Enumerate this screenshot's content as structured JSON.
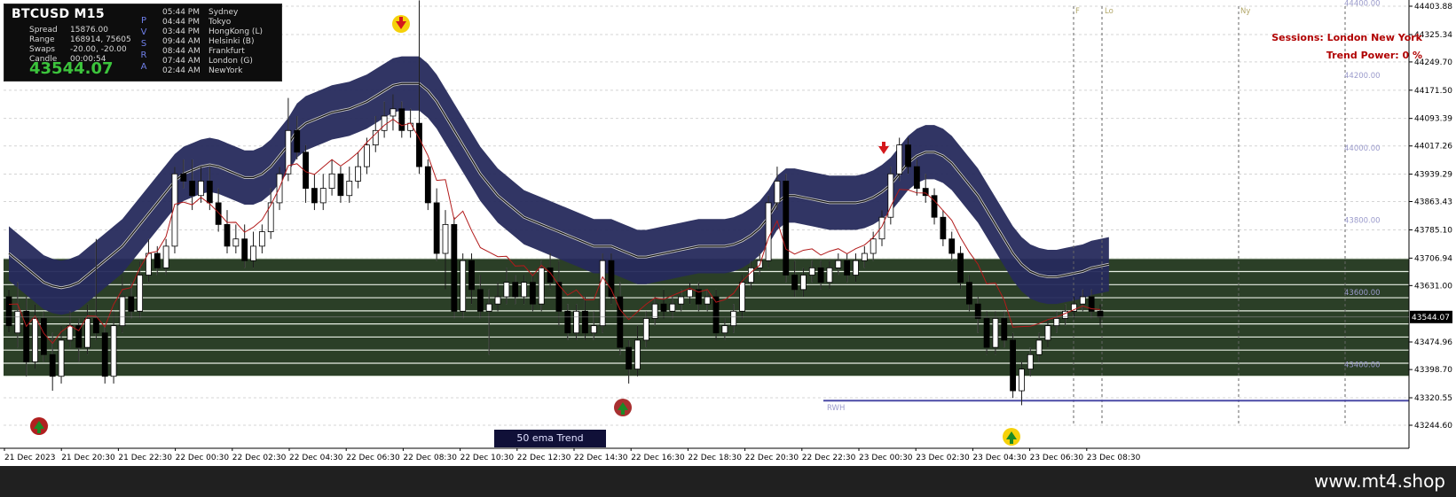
{
  "info": {
    "symbol": "BTCUSD  M15",
    "rows": [
      {
        "k": "Spread",
        "v": "15876.00"
      },
      {
        "k": "Range",
        "v": "168914, 75605"
      },
      {
        "k": "Swaps",
        "v": "-20.00, -20.00"
      },
      {
        "k": "Candle",
        "v": "00:00:54"
      }
    ],
    "bid": "43544.07",
    "pvsra_letters": [
      "P",
      "V",
      "S",
      "R",
      "A"
    ],
    "sessions": [
      {
        "t": "05:44 PM",
        "name": "Sydney"
      },
      {
        "t": "04:44 PM",
        "name": "Tokyo"
      },
      {
        "t": "03:44 PM",
        "name": "HongKong  (L)"
      },
      {
        "t": "09:44 AM",
        "name": "Helsinki  (B)"
      },
      {
        "t": "08:44 AM",
        "name": "Frankfurt"
      },
      {
        "t": "07:44 AM",
        "name": "London  (G)"
      },
      {
        "t": "02:44 AM",
        "name": "NewYork"
      }
    ]
  },
  "overlay": {
    "sessions_label": "Sessions:  London  New York",
    "trend_power": "Trend Power: 0 %",
    "ema_trend_label": "50 ema Trend",
    "rwh_label": "RWH",
    "session_markers": [
      "F",
      "Lo",
      "Ny"
    ],
    "watermark": "www.mt4.shop"
  },
  "y_axis": {
    "ticks": [
      "44403.88",
      "44325.34",
      "44249.70",
      "44171.50",
      "44093.39",
      "44017.26",
      "43939.29",
      "43863.43",
      "43785.10",
      "43706.94",
      "43631.00",
      "43474.96",
      "43398.70",
      "43320.55",
      "43244.60"
    ],
    "current_price": "43544.07"
  },
  "x_axis": {
    "ticks": [
      "21 Dec 2023",
      "21 Dec 20:30",
      "21 Dec 22:30",
      "22 Dec 00:30",
      "22 Dec 02:30",
      "22 Dec 04:30",
      "22 Dec 06:30",
      "22 Dec 08:30",
      "22 Dec 10:30",
      "22 Dec 12:30",
      "22 Dec 14:30",
      "22 Dec 16:30",
      "22 Dec 18:30",
      "22 Dec 20:30",
      "22 Dec 22:30",
      "23 Dec 00:30",
      "23 Dec 02:30",
      "23 Dec 04:30",
      "23 Dec 06:30",
      "23 Dec 08:30"
    ]
  },
  "levels": [
    "44400.00",
    "44200.00",
    "44000.00",
    "43800.00",
    "43600.00",
    "43400.00"
  ],
  "candles": [
    [
      43600,
      43620,
      43520,
      43500
    ],
    [
      43500,
      43640,
      43560,
      43460
    ],
    [
      43560,
      43600,
      43420,
      43380
    ],
    [
      43420,
      43580,
      43540,
      43400
    ],
    [
      43540,
      43560,
      43440,
      43420
    ],
    [
      43440,
      43500,
      43380,
      43340
    ],
    [
      43380,
      43520,
      43480,
      43360
    ],
    [
      43480,
      43560,
      43520,
      43460
    ],
    [
      43520,
      43540,
      43460,
      43420
    ],
    [
      43460,
      43580,
      43540,
      43440
    ],
    [
      43540,
      43760,
      43500,
      43480
    ],
    [
      43500,
      43520,
      43380,
      43360
    ],
    [
      43380,
      43560,
      43520,
      43360
    ],
    [
      43520,
      43660,
      43600,
      43500
    ],
    [
      43600,
      43640,
      43560,
      43540
    ],
    [
      43560,
      43700,
      43660,
      43540
    ],
    [
      43660,
      43760,
      43720,
      43640
    ],
    [
      43720,
      43740,
      43680,
      43660
    ],
    [
      43680,
      43760,
      43740,
      43660
    ],
    [
      43740,
      43960,
      43940,
      43720
    ],
    [
      43940,
      43980,
      43920,
      43900
    ],
    [
      43920,
      43980,
      43880,
      43840
    ],
    [
      43880,
      43960,
      43920,
      43860
    ],
    [
      43920,
      43960,
      43860,
      43840
    ],
    [
      43860,
      43900,
      43800,
      43780
    ],
    [
      43800,
      43840,
      43740,
      43720
    ],
    [
      43740,
      43800,
      43760,
      43720
    ],
    [
      43760,
      43800,
      43700,
      43680
    ],
    [
      43700,
      43780,
      43740,
      43680
    ],
    [
      43740,
      43800,
      43780,
      43720
    ],
    [
      43780,
      43900,
      43860,
      43760
    ],
    [
      43860,
      43960,
      43940,
      43840
    ],
    [
      43940,
      44150,
      44060,
      43920
    ],
    [
      44060,
      44100,
      44000,
      43980
    ],
    [
      44000,
      44020,
      43900,
      43860
    ],
    [
      43900,
      43940,
      43860,
      43840
    ],
    [
      43860,
      43940,
      43900,
      43840
    ],
    [
      43900,
      43980,
      43940,
      43880
    ],
    [
      43940,
      43960,
      43880,
      43860
    ],
    [
      43880,
      43960,
      43920,
      43860
    ],
    [
      43920,
      44000,
      43960,
      43900
    ],
    [
      43960,
      44040,
      44020,
      43940
    ],
    [
      44020,
      44100,
      44060,
      44000
    ],
    [
      44060,
      44140,
      44100,
      44040
    ],
    [
      44100,
      44160,
      44120,
      44060
    ],
    [
      44120,
      44140,
      44060,
      44040
    ],
    [
      44060,
      44120,
      44080,
      44040
    ],
    [
      44080,
      44420,
      43960,
      43940
    ],
    [
      43960,
      43980,
      43860,
      43840
    ],
    [
      43860,
      43900,
      43720,
      43700
    ],
    [
      43720,
      43840,
      43800,
      43620
    ],
    [
      43800,
      43820,
      43560,
      43540
    ],
    [
      43560,
      43720,
      43700,
      43540
    ],
    [
      43700,
      43720,
      43620,
      43580
    ],
    [
      43620,
      43660,
      43560,
      43540
    ],
    [
      43560,
      43620,
      43580,
      43440
    ],
    [
      43580,
      43640,
      43600,
      43560
    ],
    [
      43600,
      43680,
      43640,
      43580
    ],
    [
      43640,
      43660,
      43600,
      43580
    ],
    [
      43600,
      43660,
      43640,
      43580
    ],
    [
      43640,
      43660,
      43580,
      43560
    ],
    [
      43580,
      43700,
      43680,
      43560
    ],
    [
      43680,
      43720,
      43640,
      43620
    ],
    [
      43640,
      43700,
      43560,
      43520
    ],
    [
      43560,
      43580,
      43500,
      43480
    ],
    [
      43500,
      43580,
      43560,
      43480
    ],
    [
      43560,
      43600,
      43500,
      43480
    ],
    [
      43500,
      43560,
      43520,
      43480
    ],
    [
      43520,
      43720,
      43700,
      43500
    ],
    [
      43700,
      43720,
      43600,
      43580
    ],
    [
      43600,
      43640,
      43460,
      43440
    ],
    [
      43460,
      43480,
      43400,
      43360
    ],
    [
      43400,
      43520,
      43480,
      43380
    ],
    [
      43480,
      43560,
      43540,
      43460
    ],
    [
      43540,
      43600,
      43580,
      43520
    ],
    [
      43580,
      43620,
      43560,
      43540
    ],
    [
      43560,
      43600,
      43580,
      43540
    ],
    [
      43580,
      43620,
      43600,
      43560
    ],
    [
      43600,
      43640,
      43620,
      43580
    ],
    [
      43620,
      43640,
      43580,
      43560
    ],
    [
      43580,
      43620,
      43600,
      43560
    ],
    [
      43600,
      43620,
      43500,
      43480
    ],
    [
      43500,
      43540,
      43520,
      43480
    ],
    [
      43520,
      43580,
      43560,
      43500
    ],
    [
      43560,
      43660,
      43640,
      43540
    ],
    [
      43640,
      43700,
      43680,
      43620
    ],
    [
      43680,
      43720,
      43700,
      43660
    ],
    [
      43700,
      43880,
      43860,
      43680
    ],
    [
      43860,
      43960,
      43920,
      43840
    ],
    [
      43920,
      43940,
      43660,
      43640
    ],
    [
      43660,
      43700,
      43620,
      43600
    ],
    [
      43620,
      43680,
      43660,
      43600
    ],
    [
      43660,
      43700,
      43680,
      43640
    ],
    [
      43680,
      43700,
      43640,
      43620
    ],
    [
      43640,
      43700,
      43680,
      43620
    ],
    [
      43680,
      43720,
      43700,
      43660
    ],
    [
      43700,
      43720,
      43660,
      43640
    ],
    [
      43660,
      43720,
      43700,
      43640
    ],
    [
      43700,
      43740,
      43720,
      43680
    ],
    [
      43720,
      43780,
      43760,
      43700
    ],
    [
      43760,
      43840,
      43820,
      43740
    ],
    [
      43820,
      43960,
      43940,
      43800
    ],
    [
      43940,
      44040,
      44020,
      43920
    ],
    [
      44020,
      44040,
      43960,
      43940
    ],
    [
      43960,
      43980,
      43900,
      43880
    ],
    [
      43900,
      43940,
      43880,
      43860
    ],
    [
      43880,
      43900,
      43820,
      43800
    ],
    [
      43820,
      43840,
      43760,
      43740
    ],
    [
      43760,
      43780,
      43720,
      43700
    ],
    [
      43720,
      43740,
      43640,
      43620
    ],
    [
      43640,
      43660,
      43580,
      43560
    ],
    [
      43580,
      43600,
      43540,
      43500
    ],
    [
      43540,
      43560,
      43460,
      43440
    ],
    [
      43460,
      43560,
      43540,
      43440
    ],
    [
      43540,
      43560,
      43480,
      43460
    ],
    [
      43480,
      43500,
      43340,
      43320
    ],
    [
      43340,
      43420,
      43400,
      43300
    ],
    [
      43400,
      43460,
      43440,
      43380
    ],
    [
      43440,
      43500,
      43480,
      43420
    ],
    [
      43480,
      43540,
      43520,
      43460
    ],
    [
      43520,
      43560,
      43540,
      43500
    ],
    [
      43540,
      43580,
      43560,
      43520
    ],
    [
      43560,
      43600,
      43580,
      43540
    ],
    [
      43580,
      43620,
      43600,
      43560
    ],
    [
      43600,
      43620,
      43560,
      43540
    ],
    [
      43560,
      43580,
      43544,
      43520
    ]
  ],
  "ema_fast": [
    43580,
    43560,
    43540,
    43520,
    43500,
    43490,
    43485,
    43490,
    43500,
    43520,
    43540,
    43560,
    43580,
    43600,
    43630,
    43660,
    43690,
    43720,
    43750,
    43780,
    43800,
    43810,
    43820,
    43825,
    43820,
    43810,
    43800,
    43790,
    43790,
    43800,
    43820,
    43850,
    43880,
    43920,
    43940,
    43950,
    43960,
    43970,
    43975,
    43980,
    43990,
    44000,
    44015,
    44030,
    44045,
    44050,
    44050,
    44050,
    44030,
    44000,
    43960,
    43920,
    43880,
    43840,
    43800,
    43770,
    43740,
    43720,
    43700,
    43680,
    43670,
    43660,
    43650,
    43640,
    43630,
    43620,
    43610,
    43600,
    43600,
    43600,
    43590,
    43580,
    43570,
    43570,
    43575,
    43580,
    43585,
    43590,
    43595,
    43600,
    43600,
    43600,
    43600,
    43605,
    43615,
    43630,
    43650,
    43680,
    43720,
    43740,
    43740,
    43735,
    43730,
    43725,
    43720,
    43720,
    43720,
    43720,
    43725,
    43735,
    43750,
    43770,
    43800,
    43830,
    43850,
    43860,
    43860,
    43850,
    43830,
    43800,
    43770,
    43740,
    43700,
    43660,
    43620,
    43580,
    43550,
    43530,
    43520,
    43515,
    43515,
    43520,
    43525,
    43530,
    43540,
    43545,
    43550
  ]
}
